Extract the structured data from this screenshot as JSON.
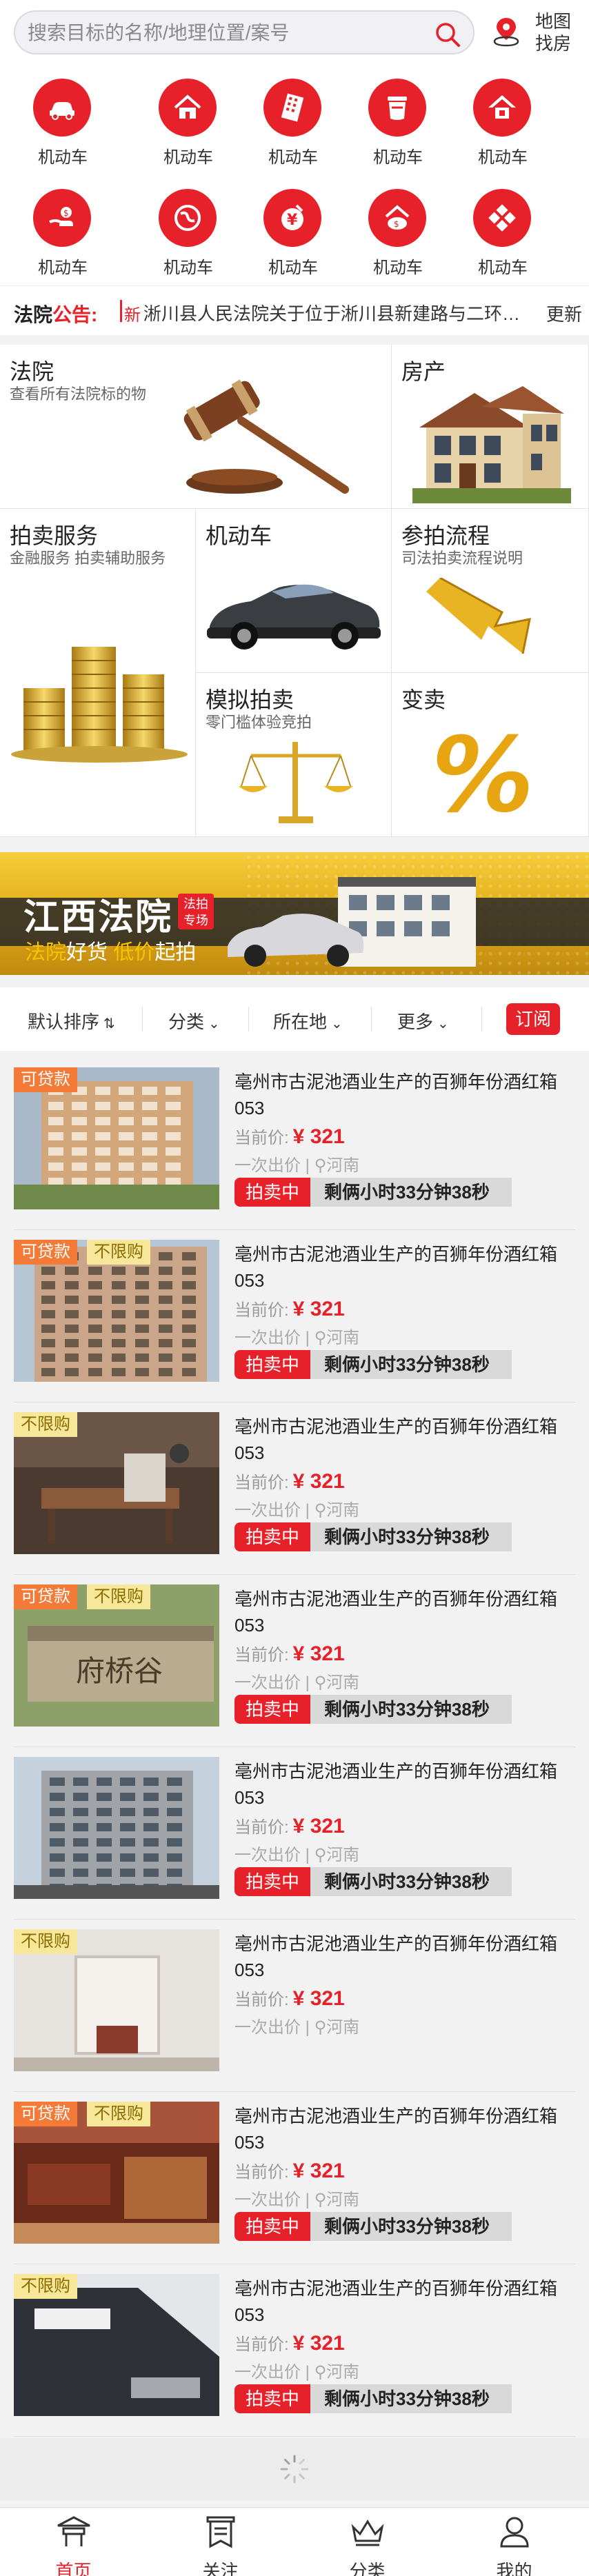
{
  "search": {
    "placeholder": "搜索目标的名称/地理位置/案号",
    "icon": "search-icon"
  },
  "map_button": {
    "line1": "地图",
    "line2": "找房",
    "icon": "map-pin-icon"
  },
  "categories": [
    {
      "label": "机动车",
      "icon": "car-icon"
    },
    {
      "label": "机动车",
      "icon": "house-icon"
    },
    {
      "label": "机动车",
      "icon": "building-icon"
    },
    {
      "label": "机动车",
      "icon": "jar-icon"
    },
    {
      "label": "机动车",
      "icon": "home-icon"
    },
    {
      "label": "机动车",
      "icon": "hand-icon"
    },
    {
      "label": "机动车",
      "icon": "globe-icon"
    },
    {
      "label": "机动车",
      "icon": "coin-icon"
    },
    {
      "label": "机动车",
      "icon": "piggy-bank-icon"
    },
    {
      "label": "机动车",
      "icon": "grid-icon"
    }
  ],
  "notice": {
    "label_black": "法院",
    "label_red": "公告:",
    "tag": "新",
    "text": "淅川县人民法院关于位于淅川县新建路与二环路交叉口房产拍卖公告",
    "more": "更新"
  },
  "features": {
    "court": {
      "title": "法院",
      "subtitle": "查看所有法院标的物"
    },
    "house": {
      "title": "房产"
    },
    "auction_service": {
      "title": "拍卖服务",
      "subtitle": "金融服务 拍卖辅助服务"
    },
    "vehicle": {
      "title": "机动车"
    },
    "process": {
      "title": "参拍流程",
      "subtitle": "司法拍卖流程说明"
    },
    "mock": {
      "title": "模拟拍卖",
      "subtitle": "零门槛体验竞拍"
    },
    "discount": {
      "title": "变卖"
    }
  },
  "banner": {
    "title": "江西法院",
    "stamp": "法拍专场",
    "slogan_a": "法院",
    "slogan_b": "好货",
    "slogan_c": " 低价",
    "slogan_d": "起拍"
  },
  "filters": {
    "sort": "默认排序",
    "category": "分类",
    "location": "所在地",
    "more": "更多",
    "subscribe": "订阅"
  },
  "listings": [
    {
      "badges": [
        "可贷款"
      ],
      "name": "亳州市古泥池酒业生产的百狮年份酒红箱053",
      "price_label": "当前价:",
      "price": "¥ 321",
      "bids": "一次出价",
      "location": "河南",
      "status": "拍卖中",
      "countdown": "剩俩小时33分钟38秒",
      "photo": "apartment-tower"
    },
    {
      "badges": [
        "可贷款",
        "不限购"
      ],
      "name": "亳州市古泥池酒业生产的百狮年份酒红箱053",
      "price_label": "当前价:",
      "price": "¥ 321",
      "bids": "一次出价",
      "location": "河南",
      "status": "拍卖中",
      "countdown": "剩俩小时33分钟38秒",
      "photo": "apartment-block"
    },
    {
      "badges": [
        "不限购"
      ],
      "name": "亳州市古泥池酒业生产的百狮年份酒红箱053",
      "price_label": "当前价:",
      "price": "¥ 321",
      "bids": "一次出价",
      "location": "河南",
      "status": "拍卖中",
      "countdown": "剩俩小时33分钟38秒",
      "photo": "office-interior"
    },
    {
      "badges": [
        "可贷款",
        "不限购"
      ],
      "name": "亳州市古泥池酒业生产的百狮年份酒红箱053",
      "price_label": "当前价:",
      "price": "¥ 321",
      "bids": "一次出价",
      "location": "河南",
      "status": "拍卖中",
      "countdown": "剩俩小时33分钟38秒",
      "photo": "stone-sign",
      "photo_text": "府桥谷"
    },
    {
      "badges": [],
      "name": "亳州市古泥池酒业生产的百狮年份酒红箱053",
      "price_label": "当前价:",
      "price": "¥ 321",
      "bids": "一次出价",
      "location": "河南",
      "status": "拍卖中",
      "countdown": "剩俩小时33分钟38秒",
      "photo": "residential-building"
    },
    {
      "badges": [
        "不限购"
      ],
      "name": "亳州市古泥池酒业生产的百狮年份酒红箱053",
      "price_label": "当前价:",
      "price": "¥ 321",
      "bids": "一次出价",
      "location": "河南",
      "status": "",
      "countdown": "",
      "photo": "room-interior"
    },
    {
      "badges": [
        "可贷款",
        "不限购"
      ],
      "name": "亳州市古泥池酒业生产的百狮年份酒红箱053",
      "price_label": "当前价:",
      "price": "¥ 321",
      "bids": "一次出价",
      "location": "河南",
      "status": "拍卖中",
      "countdown": "剩俩小时33分钟38秒",
      "photo": "wood-interior"
    },
    {
      "badges": [
        "不限购"
      ],
      "name": "亳州市古泥池酒业生产的百狮年份酒红箱053",
      "price_label": "当前价:",
      "price": "¥ 321",
      "bids": "一次出价",
      "location": "河南",
      "status": "拍卖中",
      "countdown": "剩俩小时33分钟38秒",
      "photo": "car-interior"
    }
  ],
  "tabs": [
    {
      "label": "首页",
      "icon": "home-pavilion-icon",
      "active": true
    },
    {
      "label": "关注",
      "icon": "bookmark-list-icon",
      "active": false
    },
    {
      "label": "分类",
      "icon": "crown-icon",
      "active": false
    },
    {
      "label": "我的",
      "icon": "user-icon",
      "active": false
    }
  ],
  "colors": {
    "accent": "#e6212a",
    "loan_badge": "#f47a37",
    "nolimit_badge": "#f7e79a",
    "banner_gold": "#e0a816"
  }
}
